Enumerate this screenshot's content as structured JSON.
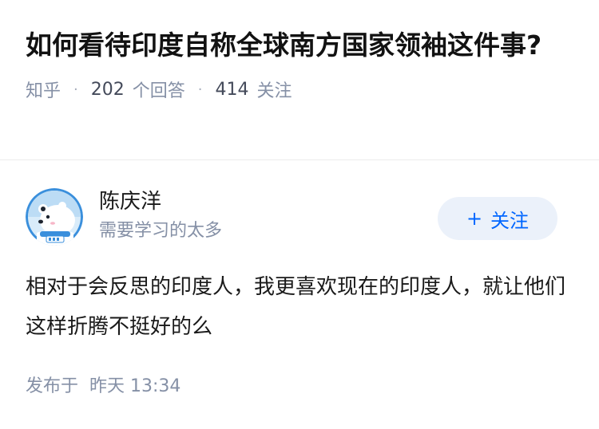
{
  "question": {
    "title": "如何看待印度自称全球南方国家领袖这件事?",
    "source": "知乎",
    "answer_count": "202",
    "answer_label": "个回答",
    "follower_count": "414",
    "follower_label": "关注"
  },
  "answer": {
    "author": {
      "name": "陈庆洋",
      "bio": "需要学习的太多",
      "avatar_icon": "polar-bear-avatar-icon"
    },
    "follow_button": {
      "plus": "+",
      "label": "关注"
    },
    "content": "相对于会反思的印度人，我更喜欢现在的印度人，就让他们这样折腾不挺好的么",
    "time_label": "发布于",
    "time_value": "昨天 13:34"
  },
  "colors": {
    "accent": "#0066ff",
    "follow_bg": "#ebf1fa",
    "meta_text": "#8590a6",
    "avatar_bg": "#3a8fdc"
  }
}
